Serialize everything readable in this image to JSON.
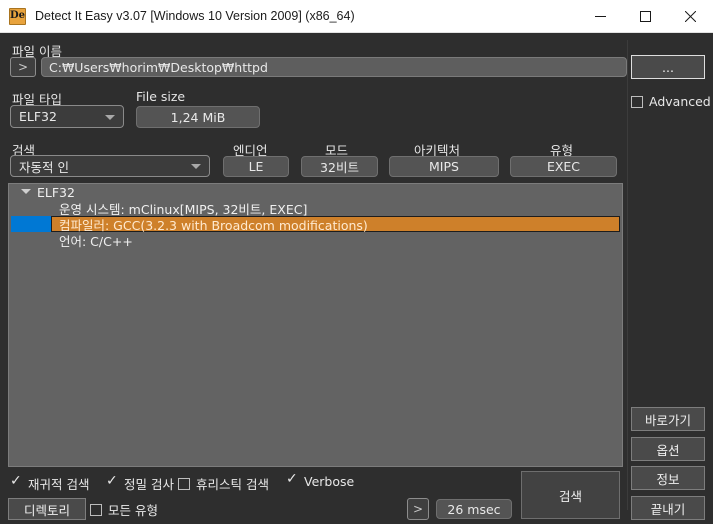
{
  "window": {
    "title": "Detect It Easy v3.07 [Windows 10 Version 2009] (x86_64)",
    "icon": "die-logo-icon",
    "minimize": "minimize-icon",
    "maximize": "maximize-icon",
    "close": "close-icon"
  },
  "filename": {
    "label": "파일 이름",
    "expand_button": ">",
    "path_value": "C:₩Users₩horim₩Desktop₩httpd",
    "browse_button": "..."
  },
  "filetype": {
    "label": "파일 타입",
    "value": "ELF32"
  },
  "filesize": {
    "label": "File size",
    "value": "1,24 MiB"
  },
  "advanced": {
    "label": "Advanced",
    "checked": false
  },
  "scan": {
    "label": "검색",
    "value": "자동적 인"
  },
  "fields": [
    {
      "label": "엔디언",
      "value": "LE"
    },
    {
      "label": "모드",
      "value": "32비트"
    },
    {
      "label": "아키텍처",
      "value": "MIPS"
    },
    {
      "label": "유형",
      "value": "EXEC"
    }
  ],
  "tree": {
    "root": "ELF32",
    "rows": [
      {
        "text": "운영 시스템: mClinux[MIPS, 32비트, EXEC]",
        "selected": false
      },
      {
        "text": "컴파일러: GCC(3.2.3 with Broadcom modifications)",
        "selected": true
      },
      {
        "text": "언어: C/C++",
        "selected": false
      }
    ]
  },
  "side_buttons": [
    {
      "label": "바로가기"
    },
    {
      "label": "옵션"
    },
    {
      "label": "정보"
    },
    {
      "label": "끝내기"
    }
  ],
  "options": [
    {
      "label": "재귀적 검색",
      "checked": true
    },
    {
      "label": "정밀 검사",
      "checked": true
    },
    {
      "label": "휴리스틱 검색",
      "checked": false
    },
    {
      "label": "Verbose",
      "checked": true
    }
  ],
  "bottom": {
    "directory_button": "디렉토리",
    "all_types": {
      "label": "모든 유형",
      "checked": false
    },
    "chevron_button": ">",
    "elapsed": "26 msec",
    "search_button": "검색"
  },
  "colors": {
    "window_bg": "#2e2e2e",
    "titlebar_bg": "#ffffff",
    "tree_bg": "#636363",
    "selection_blue": "#0078d4",
    "highlight_orange": "#ce802a",
    "accent_icon": "#e8a33d"
  }
}
